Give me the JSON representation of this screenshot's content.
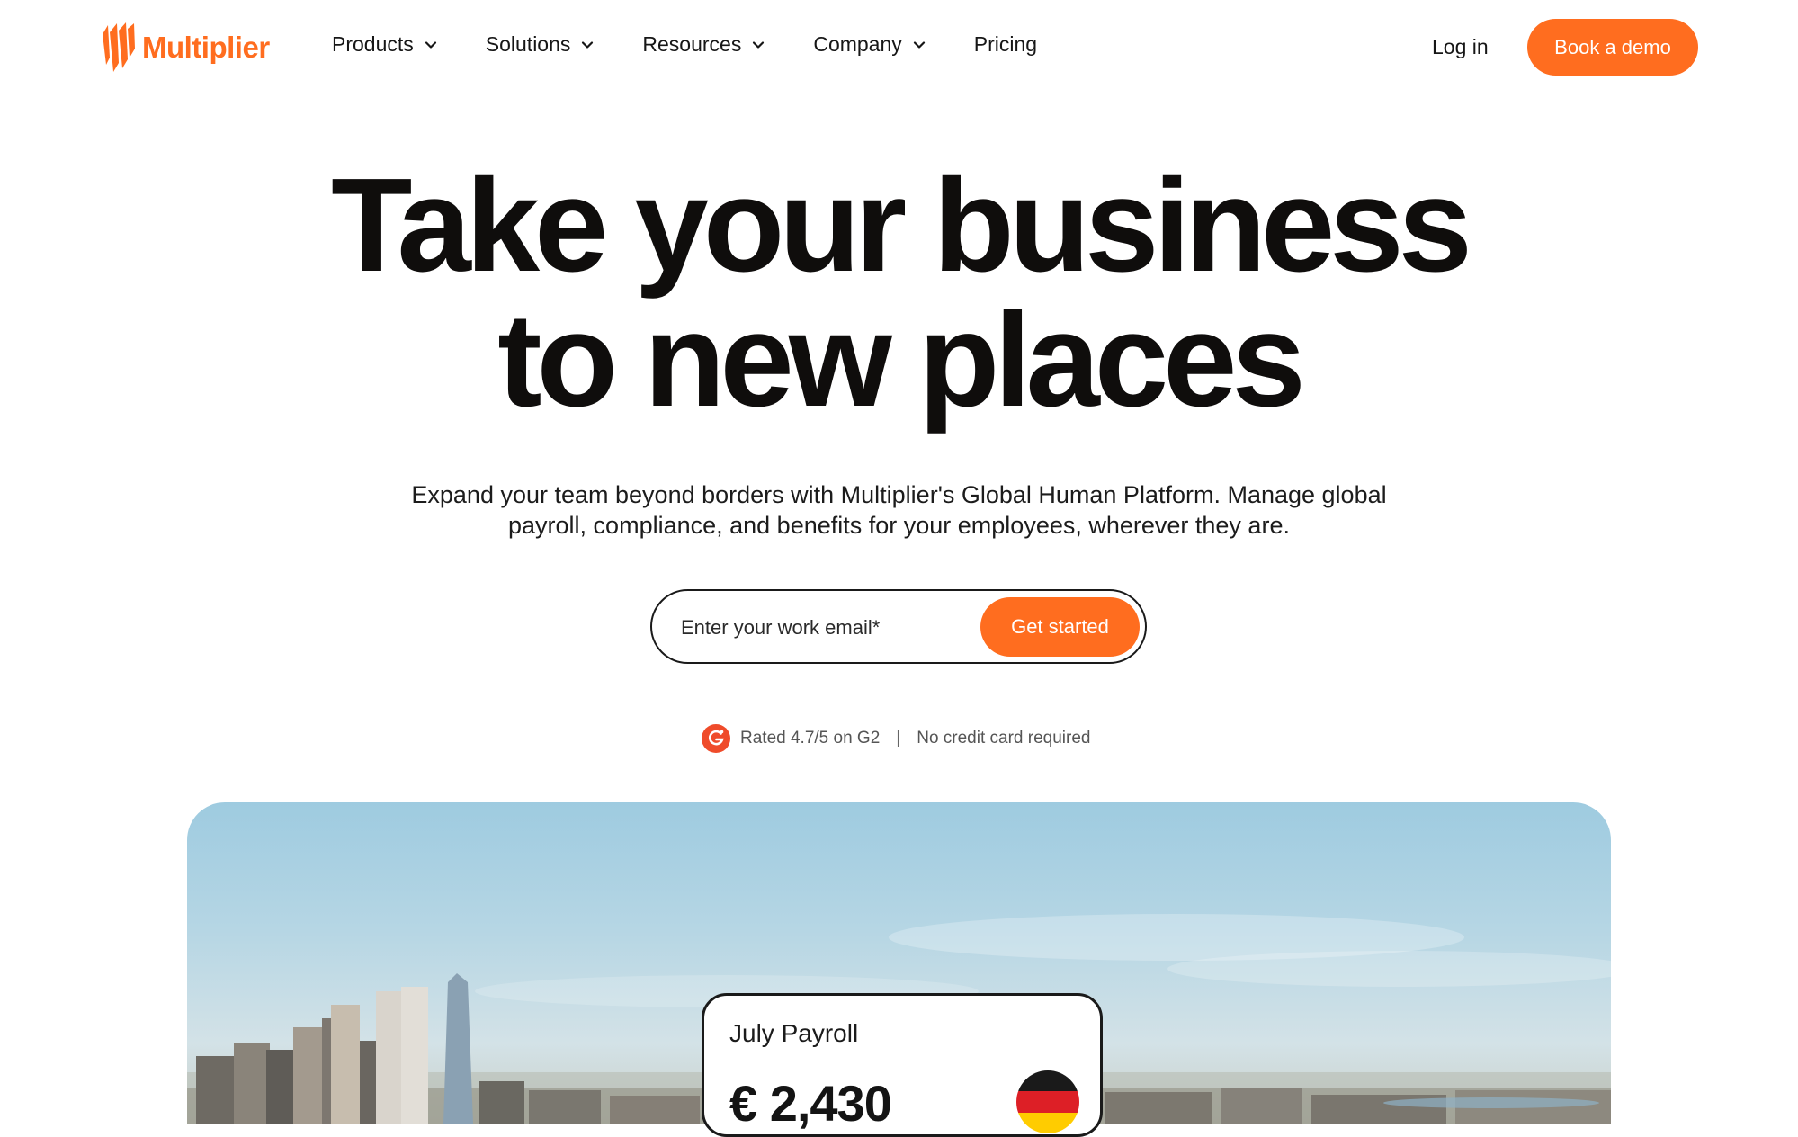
{
  "brand": {
    "name": "Multiplier",
    "accent": "#ff6d1f"
  },
  "nav": {
    "items": [
      {
        "label": "Products",
        "has_dropdown": true
      },
      {
        "label": "Solutions",
        "has_dropdown": true
      },
      {
        "label": "Resources",
        "has_dropdown": true
      },
      {
        "label": "Company",
        "has_dropdown": true
      },
      {
        "label": "Pricing",
        "has_dropdown": false
      }
    ],
    "login_label": "Log in",
    "demo_label": "Book a demo"
  },
  "hero": {
    "title_line1": "Take your business",
    "title_line2": "to new places",
    "subtitle": "Expand your team beyond borders with Multiplier's Global Human Platform. Manage global payroll, compliance, and benefits for your employees, wherever they are."
  },
  "form": {
    "email_placeholder": "Enter your work email*",
    "cta_label": "Get started"
  },
  "rating": {
    "icon": "g2-icon",
    "text": "Rated 4.7/5 on G2",
    "separator": "|",
    "note": "No credit card required"
  },
  "card": {
    "title": "July Payroll",
    "amount": "€ 2,430",
    "flag": "germany-flag-icon"
  }
}
